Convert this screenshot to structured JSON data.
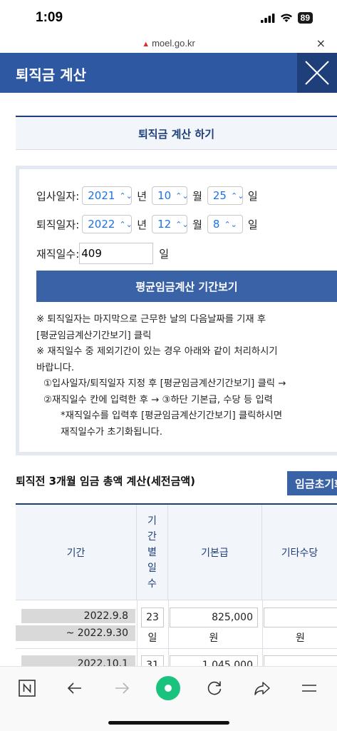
{
  "status_bar": {
    "time": "1:09",
    "battery": "89"
  },
  "browser": {
    "url": "moel.go.kr",
    "close_symbol": "×"
  },
  "header": {
    "title": "퇴직금 계산"
  },
  "calc": {
    "heading": "퇴직금 계산 하기",
    "join_label": "입사일자:",
    "join_year": "2021",
    "join_month": "10",
    "join_day": "25",
    "leave_label": "퇴직일자:",
    "leave_year": "2022",
    "leave_month": "12",
    "leave_day": "8",
    "unit_year": "년",
    "unit_month": "월",
    "unit_day": "일",
    "days_label": "재직일수:",
    "days_value": "409",
    "days_unit": "일",
    "view_button": "평균임금계산 기간보기",
    "notes": [
      "※ 퇴직일자는 마지막으로 근무한 날의 다음날짜를 기재 후",
      "[평균임금계산기간보기] 클릭",
      "※ 재직일수 중 제외기간이 있는 경우 아래와 같이 처리하시기",
      "바랍니다.",
      "①입사일자/퇴직일자 지정 후 [평균임금계산기간보기] 클릭 →",
      "②재직일수 칸에 입력한 후 → ③하단 기본급, 수당 등 입력",
      "*재직일수를 입력후 [평균임금계산기간보기] 클릭하시면",
      "재직일수가 초기화됩니다."
    ]
  },
  "wage": {
    "title": "퇴직전 3개월 임금 총액 계산(세전금액)",
    "reset_button": "임금초기화",
    "headers": {
      "period": "기간",
      "days_chars": [
        "기",
        "간",
        "별",
        "일",
        "수"
      ],
      "base_pay": "기본급",
      "other_allowance": "기타수당"
    },
    "rows": [
      {
        "period_start": "2022.9.8",
        "period_end": "~ 2022.9.30",
        "days": "23",
        "days_unit": "일",
        "base_pay": "825,000",
        "base_unit": "원",
        "other": "",
        "other_unit": "원"
      },
      {
        "period_start": "2022.10.1",
        "days": "31",
        "base_pay": "1,045,000"
      }
    ]
  },
  "bottom_nav": [
    "n-app-icon",
    "back-icon",
    "forward-icon",
    "home-icon",
    "reload-icon",
    "share-icon",
    "menu-icon"
  ]
}
